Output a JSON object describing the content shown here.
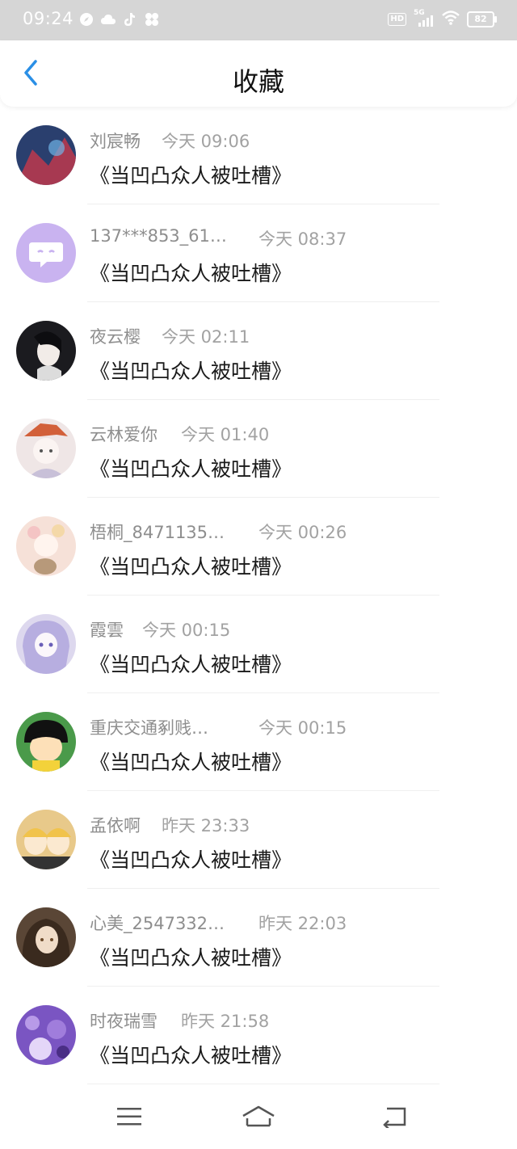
{
  "status_bar": {
    "time": "09:24",
    "left_icons": [
      "compass-icon",
      "cloud-icon",
      "tiktok-icon",
      "clover-icon"
    ],
    "hd_label": "HD",
    "network_label": "5G",
    "battery_level": "82"
  },
  "header": {
    "title": "收藏",
    "back_icon": "chevron-left-icon"
  },
  "items": [
    {
      "name": "刘宸畅",
      "time": "今天  09:06",
      "content": "《当凹凸众人被吐槽》",
      "avatar_color": "#2a3f6e"
    },
    {
      "name": "137***853_61…",
      "time": "今天  08:37",
      "content": "《当凹凸众人被吐槽》",
      "avatar_color": "#c9b3f0"
    },
    {
      "name": "夜云樱",
      "time": "今天  02:11",
      "content": "《当凹凸众人被吐槽》",
      "avatar_color": "#1b1b1f"
    },
    {
      "name": "云林爱你",
      "time": "今天  01:40",
      "content": "《当凹凸众人被吐槽》",
      "avatar_color": "#efe6e6"
    },
    {
      "name": "梧桐_8471135…",
      "time": "今天  00:26",
      "content": "《当凹凸众人被吐槽》",
      "avatar_color": "#f6e1d8"
    },
    {
      "name": "霞雲",
      "time": "今天  00:15",
      "content": "《当凹凸众人被吐槽》",
      "avatar_color": "#ddd8ee"
    },
    {
      "name": "重庆交通剢贱…",
      "time": "今天  00:15",
      "content": "《当凹凸众人被吐槽》",
      "avatar_color": "#4a9a4a"
    },
    {
      "name": "孟依啊",
      "time": "昨天  23:33",
      "content": "《当凹凸众人被吐槽》",
      "avatar_color": "#e8c98a"
    },
    {
      "name": "心美_2547332…",
      "time": "昨天  22:03",
      "content": "《当凹凸众人被吐槽》",
      "avatar_color": "#5a4636"
    },
    {
      "name": "时夜瑞雪",
      "time": "昨天  21:58",
      "content": "《当凹凸众人被吐槽》",
      "avatar_color": "#7a55c2"
    }
  ],
  "bottom_nav": {
    "menu_icon": "menu-icon",
    "home_icon": "home-icon",
    "back_icon": "back-arrow-icon"
  },
  "colors": {
    "accent": "#2a8fe6",
    "status_bar_bg": "#d6d6d6",
    "meta_text": "#8e8e8e",
    "body_text": "#1a1a1a"
  }
}
